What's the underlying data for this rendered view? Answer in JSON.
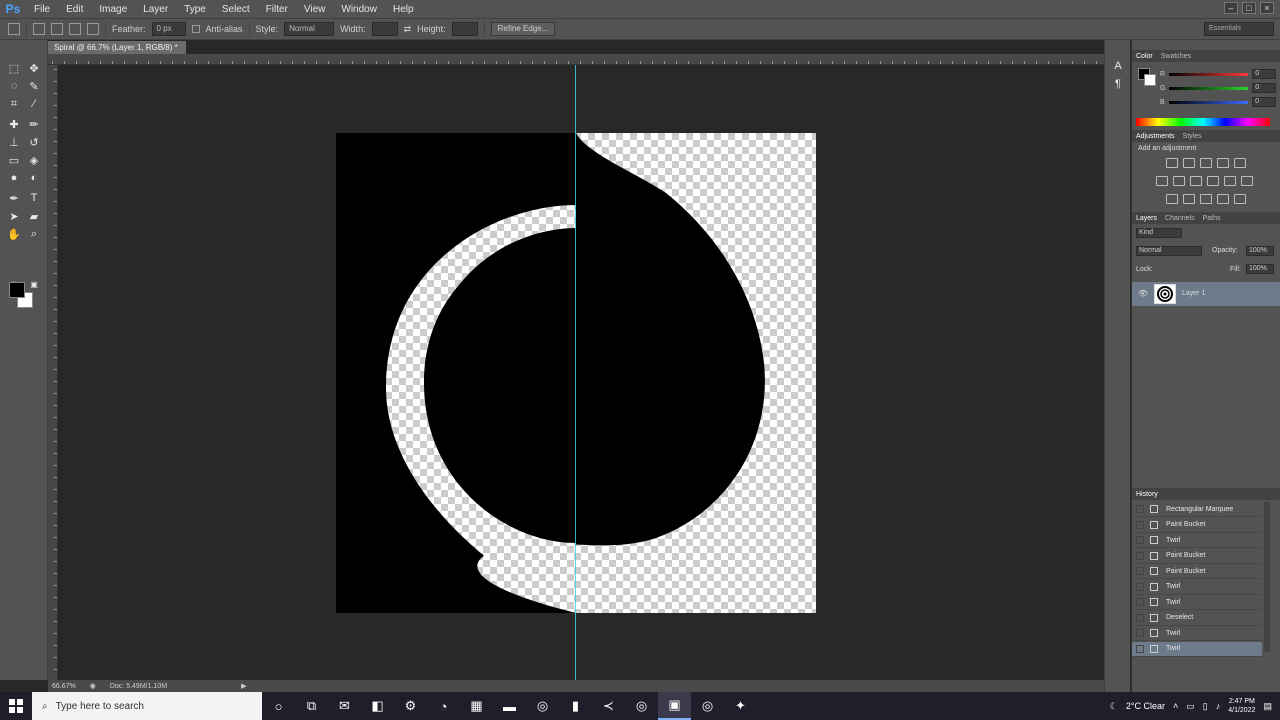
{
  "app": {
    "logo": "Ps"
  },
  "menu": [
    "File",
    "Edit",
    "Image",
    "Layer",
    "Type",
    "Select",
    "Filter",
    "View",
    "Window",
    "Help"
  ],
  "options": {
    "feather_label": "Feather:",
    "feather_value": "0 px",
    "anti_alias_label": "Anti-alias",
    "style_label": "Style:",
    "style_value": "Normal",
    "width_label": "Width:",
    "height_label": "Height:",
    "refine_label": "Refine Edge...",
    "workspace": "Essentials"
  },
  "document": {
    "tab_title": "Spiral @ 66.7% (Layer 1, RGB/8) *",
    "zoom": "66.67%",
    "doc_info": "Doc: 5.49M/1.10M"
  },
  "color_panel": {
    "tabs": [
      "Color",
      "Swatches"
    ],
    "channels": [
      {
        "label": "R",
        "value": "0",
        "color": "#ff3b3b"
      },
      {
        "label": "G",
        "value": "0",
        "color": "#2bd62b"
      },
      {
        "label": "B",
        "value": "0",
        "color": "#3b6bff"
      }
    ]
  },
  "adjustments_panel": {
    "tabs": [
      "Adjustments",
      "Styles"
    ],
    "heading": "Add an adjustment"
  },
  "layers_panel": {
    "tabs": [
      "Layers",
      "Channels",
      "Paths"
    ],
    "kind_label": "Kind",
    "blend_mode": "Normal",
    "opacity_label": "Opacity:",
    "opacity_value": "100%",
    "lock_label": "Lock:",
    "fill_label": "Fill:",
    "fill_value": "100%",
    "layer_name": "Layer 1"
  },
  "history_panel": {
    "title": "History",
    "items": [
      {
        "label": "Rectangular Marquee"
      },
      {
        "label": "Paint Bucket"
      },
      {
        "label": "Twirl"
      },
      {
        "label": "Paint Bucket"
      },
      {
        "label": "Paint Bucket"
      },
      {
        "label": "Twirl"
      },
      {
        "label": "Twirl"
      },
      {
        "label": "Deselect"
      },
      {
        "label": "Twirl"
      },
      {
        "label": "Twirl"
      }
    ]
  },
  "taskbar": {
    "search_placeholder": "Type here to search",
    "weather": "2°C  Clear",
    "time": "2:47 PM",
    "date": "4/1/2022"
  }
}
